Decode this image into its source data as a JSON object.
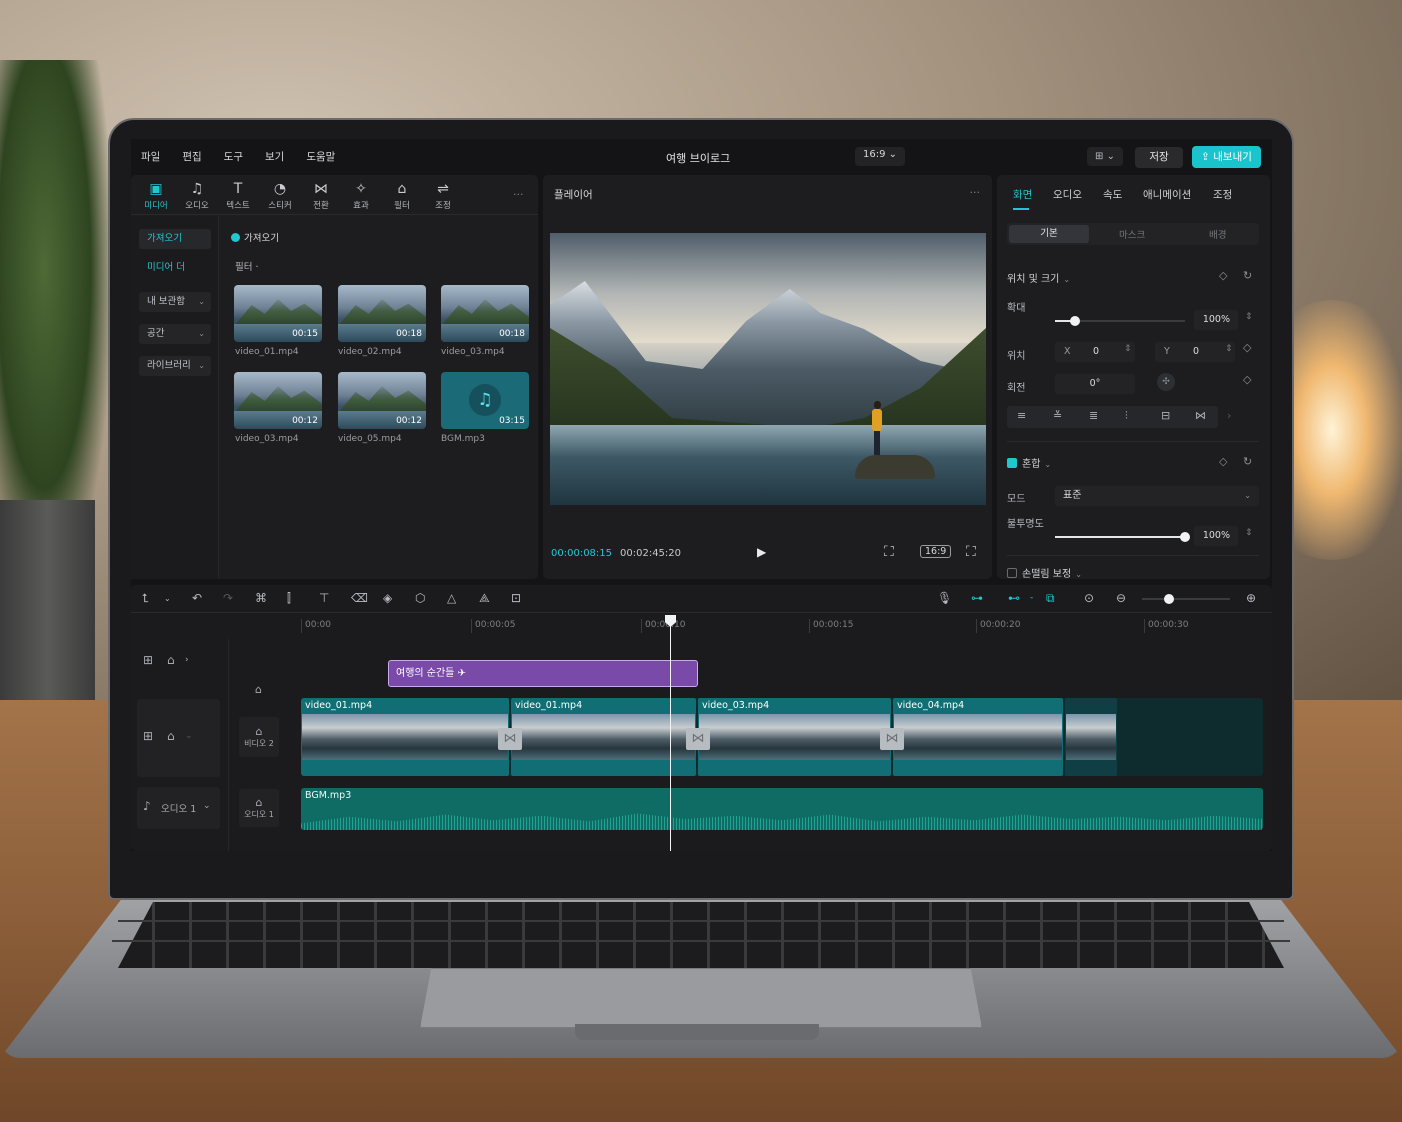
{
  "menu": {
    "items": [
      "파일",
      "편집",
      "도구",
      "보기",
      "도움말"
    ]
  },
  "project": {
    "title": "여행 브이로그",
    "ratio": "16:9"
  },
  "topbar": {
    "layout_icon": "layout-icon",
    "save": "저장",
    "export": "내보내기",
    "accent": "#19c4cc"
  },
  "media_tools": [
    {
      "icon": "media-icon",
      "glyph": "▣",
      "label": "미디어"
    },
    {
      "icon": "audio-icon",
      "glyph": "♫",
      "label": "오디오"
    },
    {
      "icon": "text-icon",
      "glyph": "T",
      "label": "텍스트"
    },
    {
      "icon": "sticker-icon",
      "glyph": "◔",
      "label": "스티커"
    },
    {
      "icon": "transition-icon",
      "glyph": "⋈",
      "label": "전환"
    },
    {
      "icon": "effect-icon",
      "glyph": "✧",
      "label": "효과"
    },
    {
      "icon": "filter-icon",
      "glyph": "⌂",
      "label": "필터"
    },
    {
      "icon": "adjust-icon",
      "glyph": "⇌",
      "label": "조정"
    }
  ],
  "sidenav": {
    "import": "가져오기",
    "media": "미디어 더",
    "my_library": "내 보관함",
    "space": "공간",
    "library": "라이브러리"
  },
  "media": {
    "import_chip": "가져오기",
    "filter": "필터",
    "items": [
      {
        "name": "video_01.mp4",
        "duration": "00:15"
      },
      {
        "name": "video_02.mp4",
        "duration": "00:18"
      },
      {
        "name": "video_03.mp4",
        "duration": "00:18"
      },
      {
        "name": "video_03.mp4",
        "duration": "00:12"
      },
      {
        "name": "video_05.mp4",
        "duration": "00:12"
      },
      {
        "name": "BGM.mp3",
        "duration": "03:15"
      }
    ]
  },
  "player": {
    "title": "플레이어",
    "current_time": "00:00:08:15",
    "total_time": "00:02:45:20",
    "ratio": "16:9"
  },
  "props": {
    "tabs": [
      "화면",
      "오디오",
      "속도",
      "애니메이션",
      "조정"
    ],
    "subtabs": [
      "기본",
      "마스크",
      "배경"
    ],
    "position_size": "위치 및 크기",
    "scale_label": "확대",
    "scale_value": "100%",
    "scale_level": 1.0,
    "position_label": "위치",
    "x_label": "X",
    "x_value": "0",
    "y_label": "Y",
    "y_value": "0",
    "rotation_label": "회전",
    "rotation_value": "0°",
    "blend_label": "혼합",
    "mode_label": "모드",
    "mode_value": "표준",
    "opacity_label": "불투명도",
    "opacity_value": "100%",
    "opacity_level": 1.0,
    "stabilize_label": "손떨림 보정"
  },
  "timeline": {
    "ruler": [
      "00:00",
      "00:00:05",
      "00:00:10",
      "00:00:15",
      "00:00:20",
      "00:00:30"
    ],
    "text_clip": "여행의 순간들 ✈",
    "video_clips": [
      "video_01.mp4",
      "video_01.mp4",
      "video_03.mp4",
      "video_04.mp4"
    ],
    "video_track_label": "비디오 2",
    "audio_track_label": "오디오 1",
    "audio_header": "오디오 1",
    "audio_clip": "BGM.mp3"
  }
}
